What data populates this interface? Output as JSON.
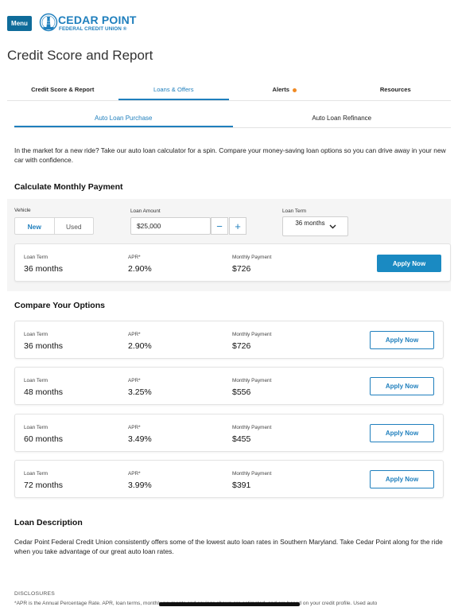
{
  "header": {
    "menu_label": "Menu",
    "logo_name": "CEDAR POINT",
    "logo_sub": "FEDERAL CREDIT UNION ®"
  },
  "page_title": "Credit Score and Report",
  "main_tabs": [
    {
      "label": "Credit Score & Report",
      "active": false
    },
    {
      "label": "Loans & Offers",
      "active": true
    },
    {
      "label": "Alerts",
      "active": false,
      "badge_color": "#f08a24"
    },
    {
      "label": "Resources",
      "active": false
    }
  ],
  "sub_tabs": [
    {
      "label": "Auto Loan Purchase",
      "active": true
    },
    {
      "label": "Auto Loan Refinance",
      "active": false
    }
  ],
  "intro": "In the market for a new ride? Take our auto loan calculator for a spin. Compare your money-saving loan options so you can drive away in your new car with confidence.",
  "calculator": {
    "title": "Calculate Monthly Payment",
    "vehicle_label": "Vehicle",
    "vehicle_options": [
      "New",
      "Used"
    ],
    "vehicle_selected": "New",
    "amount_label": "Loan Amount",
    "amount_value": "$25,000",
    "minus_label": "−",
    "plus_label": "+",
    "term_label": "Loan Term",
    "term_value": "36 months",
    "result": {
      "term_label": "Loan Term",
      "term": "36 months",
      "apr_label": "APR*",
      "apr": "2.90%",
      "payment_label": "Monthly Payment",
      "payment": "$726",
      "apply_label": "Apply Now"
    }
  },
  "compare": {
    "title": "Compare Your Options",
    "options": [
      {
        "term_label": "Loan Term",
        "term": "36 months",
        "apr_label": "APR*",
        "apr": "2.90%",
        "payment_label": "Monthly Payment",
        "payment": "$726",
        "apply_label": "Apply Now"
      },
      {
        "term_label": "Loan Term",
        "term": "48 months",
        "apr_label": "APR*",
        "apr": "3.25%",
        "payment_label": "Monthly Payment",
        "payment": "$556",
        "apply_label": "Apply Now"
      },
      {
        "term_label": "Loan Term",
        "term": "60 months",
        "apr_label": "APR*",
        "apr": "3.49%",
        "payment_label": "Monthly Payment",
        "payment": "$455",
        "apply_label": "Apply Now"
      },
      {
        "term_label": "Loan Term",
        "term": "72 months",
        "apr_label": "APR*",
        "apr": "3.99%",
        "payment_label": "Monthly Payment",
        "payment": "$391",
        "apply_label": "Apply Now"
      }
    ]
  },
  "description": {
    "title": "Loan Description",
    "text": "Cedar Point Federal Credit Union consistently offers some of the lowest auto loan rates in Southern Maryland. Take Cedar Point along for the ride when you take advantage of our great auto loan rates."
  },
  "disclosures": {
    "title": "DISCLOSURES",
    "text": "*APR is the Annual Percentage Rate. APR, loan terms, monthly payments and savings shown are estimated, and are based on your credit profile. Used auto"
  },
  "colors": {
    "brand": "#1f7fbd",
    "menu_button": "#0f6c9a",
    "apply_filled": "#1a8ac2",
    "alert_dot": "#f08a24"
  }
}
